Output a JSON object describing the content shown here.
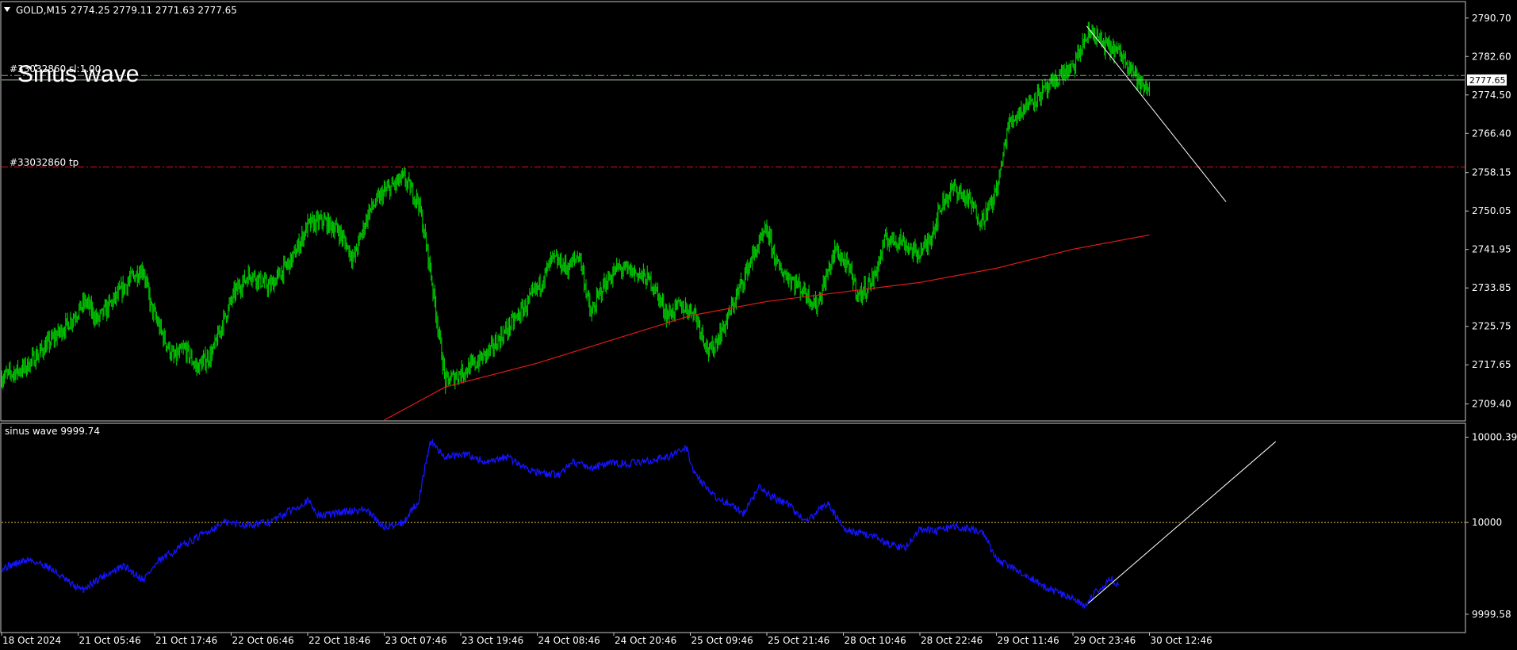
{
  "header": {
    "symbol": "GOLD,M15",
    "ohlc": "2774.25 2779.11 2771.63 2777.65",
    "overlay_title": "Sinus wave"
  },
  "orders": {
    "sl_label": "#33032860 sl:1.00",
    "tp_label": "#33032860 tp",
    "sl_price": 2778.6,
    "tp_price": 2759.3,
    "current_price_label": "2777.65",
    "current_price": 2777.65
  },
  "colors": {
    "background": "#000000",
    "candles": "#00C800",
    "moving_average": "#E11A1A",
    "indicator": "#1414FF",
    "trendline": "#FFFFFF",
    "sl_line": "#5AC85A",
    "tp_line": "#E01010",
    "level_line": "#E0C040",
    "price_box": "#FFFFFF"
  },
  "chart_data": [
    {
      "type": "candlestick",
      "title": "GOLD,M15",
      "ylim": [
        2706.0,
        2794.0
      ],
      "y_ticks": [
        "2790.70",
        "2782.60",
        "2774.50",
        "2766.40",
        "2758.15",
        "2750.05",
        "2741.95",
        "2733.85",
        "2725.75",
        "2717.65",
        "2709.40"
      ],
      "y_tick_values": [
        2790.7,
        2782.6,
        2774.5,
        2766.4,
        2758.15,
        2750.05,
        2741.95,
        2733.85,
        2725.75,
        2717.65,
        2709.4
      ],
      "x_ticks": [
        "18 Oct 2024",
        "21 Oct 05:46",
        "21 Oct 17:46",
        "22 Oct 06:46",
        "22 Oct 18:46",
        "23 Oct 07:46",
        "23 Oct 19:46",
        "24 Oct 08:46",
        "24 Oct 20:46",
        "25 Oct 09:46",
        "25 Oct 21:46",
        "28 Oct 10:46",
        "28 Oct 22:46",
        "29 Oct 11:46",
        "29 Oct 23:46",
        "30 Oct 12:46"
      ],
      "close_profile": [
        [
          0,
          2715
        ],
        [
          0.3,
          2717
        ],
        [
          0.6,
          2722
        ],
        [
          0.85,
          2726
        ],
        [
          1.1,
          2731
        ],
        [
          1.25,
          2727
        ],
        [
          1.45,
          2731
        ],
        [
          1.7,
          2736
        ],
        [
          1.85,
          2738
        ],
        [
          1.95,
          2730
        ],
        [
          2.1,
          2724
        ],
        [
          2.25,
          2719
        ],
        [
          2.4,
          2721
        ],
        [
          2.55,
          2717
        ],
        [
          2.75,
          2720
        ],
        [
          2.9,
          2727
        ],
        [
          3.05,
          2733
        ],
        [
          3.25,
          2737
        ],
        [
          3.5,
          2734
        ],
        [
          3.8,
          2740
        ],
        [
          4.0,
          2747
        ],
        [
          4.2,
          2748
        ],
        [
          4.4,
          2746
        ],
        [
          4.6,
          2740
        ],
        [
          4.8,
          2750
        ],
        [
          5.0,
          2754
        ],
        [
          5.25,
          2757
        ],
        [
          5.45,
          2752
        ],
        [
          5.6,
          2738
        ],
        [
          5.8,
          2714
        ],
        [
          6.0,
          2716
        ],
        [
          6.2,
          2718
        ],
        [
          6.4,
          2721
        ],
        [
          6.6,
          2725
        ],
        [
          6.85,
          2730
        ],
        [
          7.05,
          2735
        ],
        [
          7.2,
          2740
        ],
        [
          7.4,
          2738
        ],
        [
          7.55,
          2741
        ],
        [
          7.7,
          2728
        ],
        [
          7.85,
          2734
        ],
        [
          8.05,
          2738
        ],
        [
          8.3,
          2737
        ],
        [
          8.5,
          2735
        ],
        [
          8.7,
          2728
        ],
        [
          8.85,
          2730
        ],
        [
          9.05,
          2729
        ],
        [
          9.25,
          2720
        ],
        [
          9.45,
          2726
        ],
        [
          9.6,
          2732
        ],
        [
          9.8,
          2740
        ],
        [
          10.0,
          2746
        ],
        [
          10.15,
          2738
        ],
        [
          10.3,
          2736
        ],
        [
          10.5,
          2733
        ],
        [
          10.65,
          2730
        ],
        [
          10.9,
          2742
        ],
        [
          11.1,
          2737
        ],
        [
          11.2,
          2732
        ],
        [
          11.4,
          2736
        ],
        [
          11.55,
          2744
        ],
        [
          11.75,
          2744
        ],
        [
          11.95,
          2741
        ],
        [
          12.1,
          2743
        ],
        [
          12.3,
          2752
        ],
        [
          12.45,
          2755
        ],
        [
          12.65,
          2752
        ],
        [
          12.8,
          2748
        ],
        [
          12.95,
          2752
        ],
        [
          13.05,
          2758
        ],
        [
          13.15,
          2768
        ],
        [
          13.3,
          2771
        ],
        [
          13.5,
          2774
        ],
        [
          13.7,
          2776
        ],
        [
          13.85,
          2779
        ],
        [
          14.0,
          2780
        ],
        [
          14.15,
          2786
        ],
        [
          14.25,
          2788
        ],
        [
          14.4,
          2785
        ],
        [
          14.55,
          2784
        ],
        [
          14.75,
          2781
        ],
        [
          14.9,
          2776
        ],
        [
          15.0,
          2776
        ]
      ],
      "moving_average": [
        [
          5.0,
          2706
        ],
        [
          5.8,
          2713
        ],
        [
          7.0,
          2718
        ],
        [
          8.0,
          2723
        ],
        [
          9.0,
          2728
        ],
        [
          10.0,
          2731
        ],
        [
          11.0,
          2733
        ],
        [
          12.0,
          2735
        ],
        [
          13.0,
          2738
        ],
        [
          14.0,
          2742
        ],
        [
          15.0,
          2745
        ]
      ]
    },
    {
      "type": "line",
      "title": "sinus wave 9999.74",
      "ylim": [
        9999.5,
        10000.45
      ],
      "y_ticks": [
        "10000.39",
        "10000",
        "9999.58"
      ],
      "y_tick_values": [
        10000.39,
        10000,
        9999.58
      ],
      "level": 10000,
      "series_profile": [
        [
          0,
          9999.79
        ],
        [
          0.35,
          9999.83
        ],
        [
          0.6,
          9999.8
        ],
        [
          0.9,
          9999.72
        ],
        [
          1.05,
          9999.69
        ],
        [
          1.3,
          9999.75
        ],
        [
          1.6,
          9999.8
        ],
        [
          1.85,
          9999.74
        ],
        [
          2.05,
          9999.82
        ],
        [
          2.3,
          9999.88
        ],
        [
          2.6,
          9999.94
        ],
        [
          2.9,
          10000.0
        ],
        [
          3.2,
          9999.99
        ],
        [
          3.5,
          10000.0
        ],
        [
          3.8,
          10000.06
        ],
        [
          4.0,
          10000.1
        ],
        [
          4.15,
          10000.03
        ],
        [
          4.5,
          10000.05
        ],
        [
          4.75,
          10000.06
        ],
        [
          5.0,
          9999.98
        ],
        [
          5.25,
          10000.0
        ],
        [
          5.45,
          10000.1
        ],
        [
          5.6,
          10000.37
        ],
        [
          5.8,
          10000.3
        ],
        [
          6.1,
          10000.31
        ],
        [
          6.35,
          10000.27
        ],
        [
          6.6,
          10000.3
        ],
        [
          6.85,
          10000.25
        ],
        [
          7.1,
          10000.22
        ],
        [
          7.3,
          10000.22
        ],
        [
          7.45,
          10000.28
        ],
        [
          7.7,
          10000.25
        ],
        [
          7.95,
          10000.27
        ],
        [
          8.2,
          10000.27
        ],
        [
          8.45,
          10000.28
        ],
        [
          8.7,
          10000.3
        ],
        [
          8.95,
          10000.34
        ],
        [
          9.05,
          10000.23
        ],
        [
          9.3,
          10000.12
        ],
        [
          9.55,
          10000.08
        ],
        [
          9.7,
          10000.04
        ],
        [
          9.9,
          10000.16
        ],
        [
          10.05,
          10000.12
        ],
        [
          10.3,
          10000.08
        ],
        [
          10.5,
          10000.0
        ],
        [
          10.8,
          10000.09
        ],
        [
          11.0,
          9999.97
        ],
        [
          11.2,
          9999.95
        ],
        [
          11.4,
          9999.94
        ],
        [
          11.6,
          9999.9
        ],
        [
          11.8,
          9999.88
        ],
        [
          12.0,
          9999.97
        ],
        [
          12.2,
          9999.96
        ],
        [
          12.45,
          9999.98
        ],
        [
          12.7,
          9999.97
        ],
        [
          12.85,
          9999.94
        ],
        [
          13.0,
          9999.83
        ],
        [
          13.15,
          9999.8
        ],
        [
          13.4,
          9999.76
        ],
        [
          13.6,
          9999.71
        ],
        [
          13.8,
          9999.68
        ],
        [
          14.0,
          9999.65
        ],
        [
          14.15,
          9999.62
        ],
        [
          14.3,
          9999.68
        ],
        [
          14.5,
          9999.74
        ],
        [
          14.6,
          9999.72
        ]
      ]
    }
  ],
  "trendlines": {
    "main": [
      [
        14.18,
        2789
      ],
      [
        16.0,
        2752
      ]
    ],
    "indicator": [
      [
        14.2,
        9999.63
      ],
      [
        16.65,
        10000.37
      ]
    ]
  }
}
